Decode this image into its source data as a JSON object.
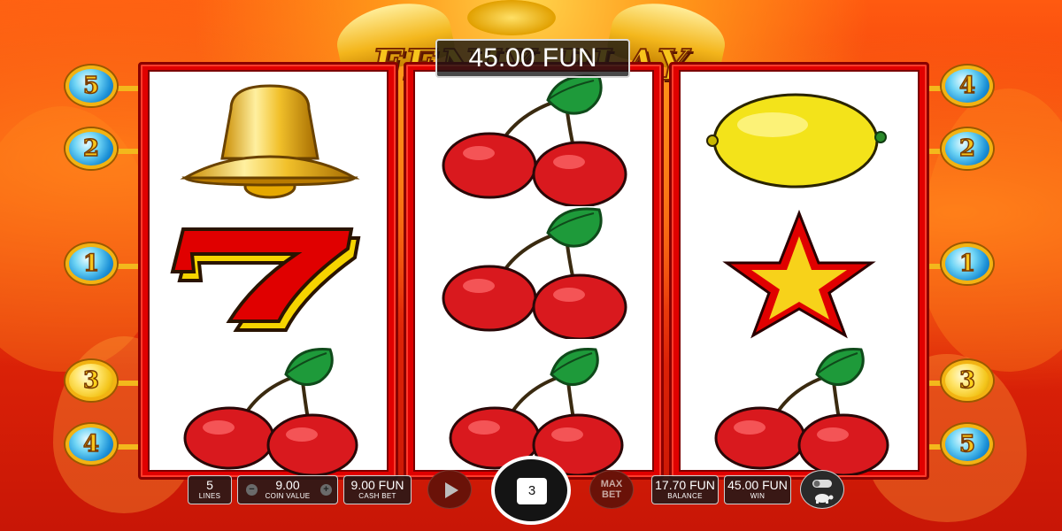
{
  "game": {
    "title": "FENIX PLAY",
    "win_display": "45.00 FUN"
  },
  "reels": [
    {
      "symbols": [
        "bell",
        "seven",
        "cherries"
      ]
    },
    {
      "symbols": [
        "cherries",
        "cherries",
        "cherries"
      ]
    },
    {
      "symbols": [
        "lemon",
        "star",
        "cherries"
      ]
    }
  ],
  "paylines": {
    "left": [
      "5",
      "2",
      "1",
      "3",
      "4"
    ],
    "right": [
      "4",
      "2",
      "1",
      "3",
      "5"
    ],
    "highlighted": "3"
  },
  "controls": {
    "lines": {
      "value": "5",
      "label": "LINES"
    },
    "coin_value": {
      "value": "9.00",
      "label": "COIN VALUE",
      "minus": "−",
      "plus": "+"
    },
    "cash_bet": {
      "value": "9.00 FUN",
      "label": "CASH BET"
    },
    "autoplay_count": "3",
    "max_bet": {
      "line1": "MAX",
      "line2": "BET"
    },
    "balance": {
      "value": "17.70 FUN",
      "label": "BALANCE"
    },
    "win": {
      "value": "45.00 FUN",
      "label": "WIN"
    }
  },
  "icons": {
    "spin": "play-icon",
    "turbo": "turtle-toggle-icon"
  },
  "colors": {
    "reel_frame": "#e00000",
    "marker_blue": "#1a8fd6",
    "marker_gold": "#f3c419",
    "logo_gold": "#f7c51c"
  }
}
